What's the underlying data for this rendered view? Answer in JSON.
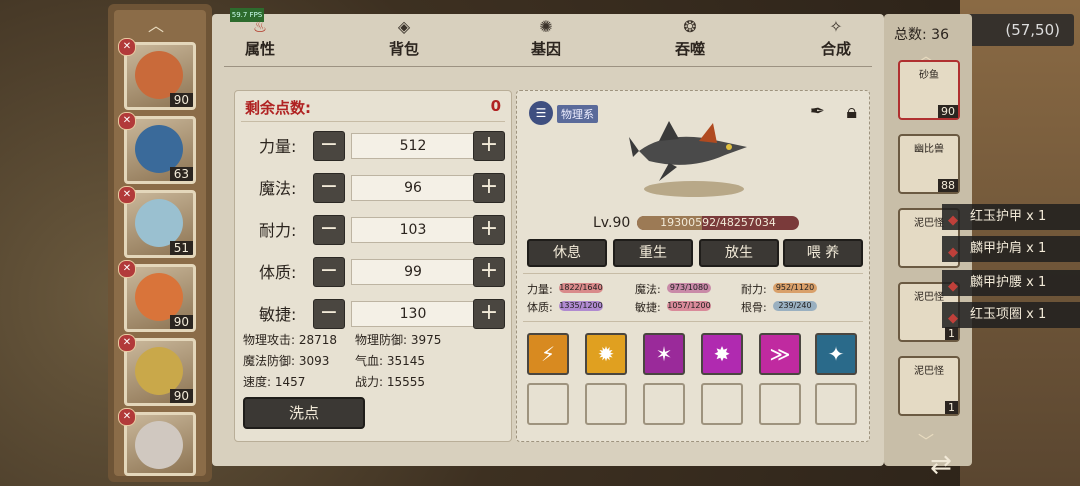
{
  "hud": {
    "fps": "59.7 FPS",
    "coords": "(57,50)"
  },
  "tabs": [
    {
      "label": "属性",
      "icon": "flame-icon",
      "glyph": "♨"
    },
    {
      "label": "背包",
      "icon": "bag-icon",
      "glyph": "◈"
    },
    {
      "label": "基因",
      "icon": "gene-icon",
      "glyph": "✺"
    },
    {
      "label": "吞噬",
      "icon": "devour-icon",
      "glyph": "❂"
    },
    {
      "label": "合成",
      "icon": "merge-icon",
      "glyph": "✧"
    }
  ],
  "left_portraits": [
    {
      "level": "90"
    },
    {
      "level": "63"
    },
    {
      "level": "51"
    },
    {
      "level": "90"
    },
    {
      "level": "90"
    },
    {
      "level": ""
    }
  ],
  "attributes": {
    "remaining_label": "剩余点数:",
    "remaining_value": "0",
    "stats": [
      {
        "name": "力量:",
        "value": "512"
      },
      {
        "name": "魔法:",
        "value": "96"
      },
      {
        "name": "耐力:",
        "value": "103"
      },
      {
        "name": "体质:",
        "value": "99"
      },
      {
        "name": "敏捷:",
        "value": "130"
      }
    ],
    "derived": [
      "物理攻击: 28718",
      "物理防御: 3975",
      "魔法防御: 3093",
      "气血: 35145",
      "速度: 1457",
      "战力: 15555"
    ],
    "reset_label": "洗点"
  },
  "creature": {
    "type_tag": "物理系",
    "level": "Lv.90",
    "hp_text": "19300592/48257034",
    "hp_fraction": 0.4,
    "actions": [
      "休息",
      "重生",
      "放生",
      "喂 养"
    ],
    "stats": [
      {
        "label": "力量:",
        "value": "1822/1640",
        "color": "#d98a8a"
      },
      {
        "label": "魔法:",
        "value": "973/1080",
        "color": "#c98aa8"
      },
      {
        "label": "耐力:",
        "value": "952/1120",
        "color": "#d9a06a"
      },
      {
        "label": "体质:",
        "value": "1335/1200",
        "color": "#b08ad0"
      },
      {
        "label": "敏捷:",
        "value": "1057/1200",
        "color": "#d98a9a"
      },
      {
        "label": "根骨:",
        "value": "239/240",
        "color": "#9ab0c0"
      }
    ],
    "skills": [
      {
        "icon": "claw-icon",
        "color": "#d88a20",
        "glyph": "⚡"
      },
      {
        "icon": "sun-icon",
        "color": "#e0a020",
        "glyph": "✹"
      },
      {
        "icon": "slash-icon",
        "color": "#9a2a9a",
        "glyph": "✶"
      },
      {
        "icon": "burst-icon",
        "color": "#b02ab0",
        "glyph": "✸"
      },
      {
        "icon": "strike-icon",
        "color": "#c02aa0",
        "glyph": "≫"
      },
      {
        "icon": "shard-icon",
        "color": "#2a6a8a",
        "glyph": "✦"
      }
    ]
  },
  "roster": {
    "total_label": "总数: 36",
    "cards": [
      {
        "name": "砂鱼",
        "level": "90"
      },
      {
        "name": "幽比兽",
        "level": "88"
      },
      {
        "name": "泥巴怪",
        "level": ""
      },
      {
        "name": "泥巴怪",
        "level": "1"
      },
      {
        "name": "泥巴怪",
        "level": "1"
      }
    ]
  },
  "equipment": [
    "红玉护甲 x 1",
    "麟甲护肩 x 1",
    "麟甲护腰 x 1",
    "红玉项圈 x 1"
  ]
}
